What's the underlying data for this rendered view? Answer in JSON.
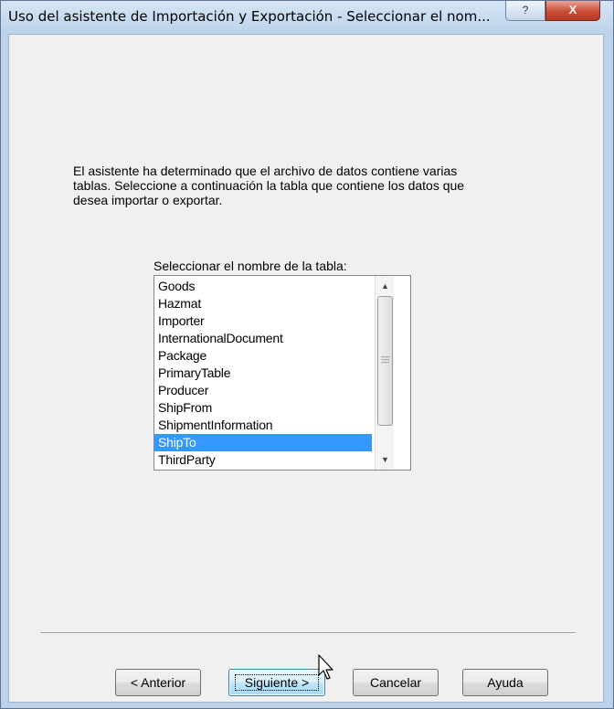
{
  "window": {
    "title": "Uso del asistente de Importación y Exportación - Seleccionar el nom...",
    "help_label": "?",
    "close_label": "X"
  },
  "instructions": {
    "line1": "El asistente ha determinado que el archivo de datos contiene varias",
    "line2": "tablas. Seleccione a continuación la tabla que contiene los datos que",
    "line3": "desea importar o exportar."
  },
  "table_list": {
    "label": "Seleccionar el nombre de la tabla:",
    "items": [
      "Goods",
      "Hazmat",
      "Importer",
      "InternationalDocument",
      "Package",
      "PrimaryTable",
      "Producer",
      "ShipFrom",
      "ShipmentInformation",
      "ShipTo",
      "ThirdParty"
    ],
    "selected": "ShipTo"
  },
  "buttons": {
    "back": "< Anterior",
    "next": "Siguiente >",
    "cancel": "Cancelar",
    "help": "Ayuda"
  },
  "icons": {
    "help": "help-icon",
    "close": "close-icon",
    "scroll_up": "scroll-up-arrow-icon",
    "scroll_down": "scroll-down-arrow-icon",
    "cursor": "mouse-pointer-icon"
  },
  "colors": {
    "selection": "#3399ff",
    "close_button": "#c94d38",
    "frame": "#bcd3ea",
    "dialog_bg": "#f0f0f0"
  }
}
